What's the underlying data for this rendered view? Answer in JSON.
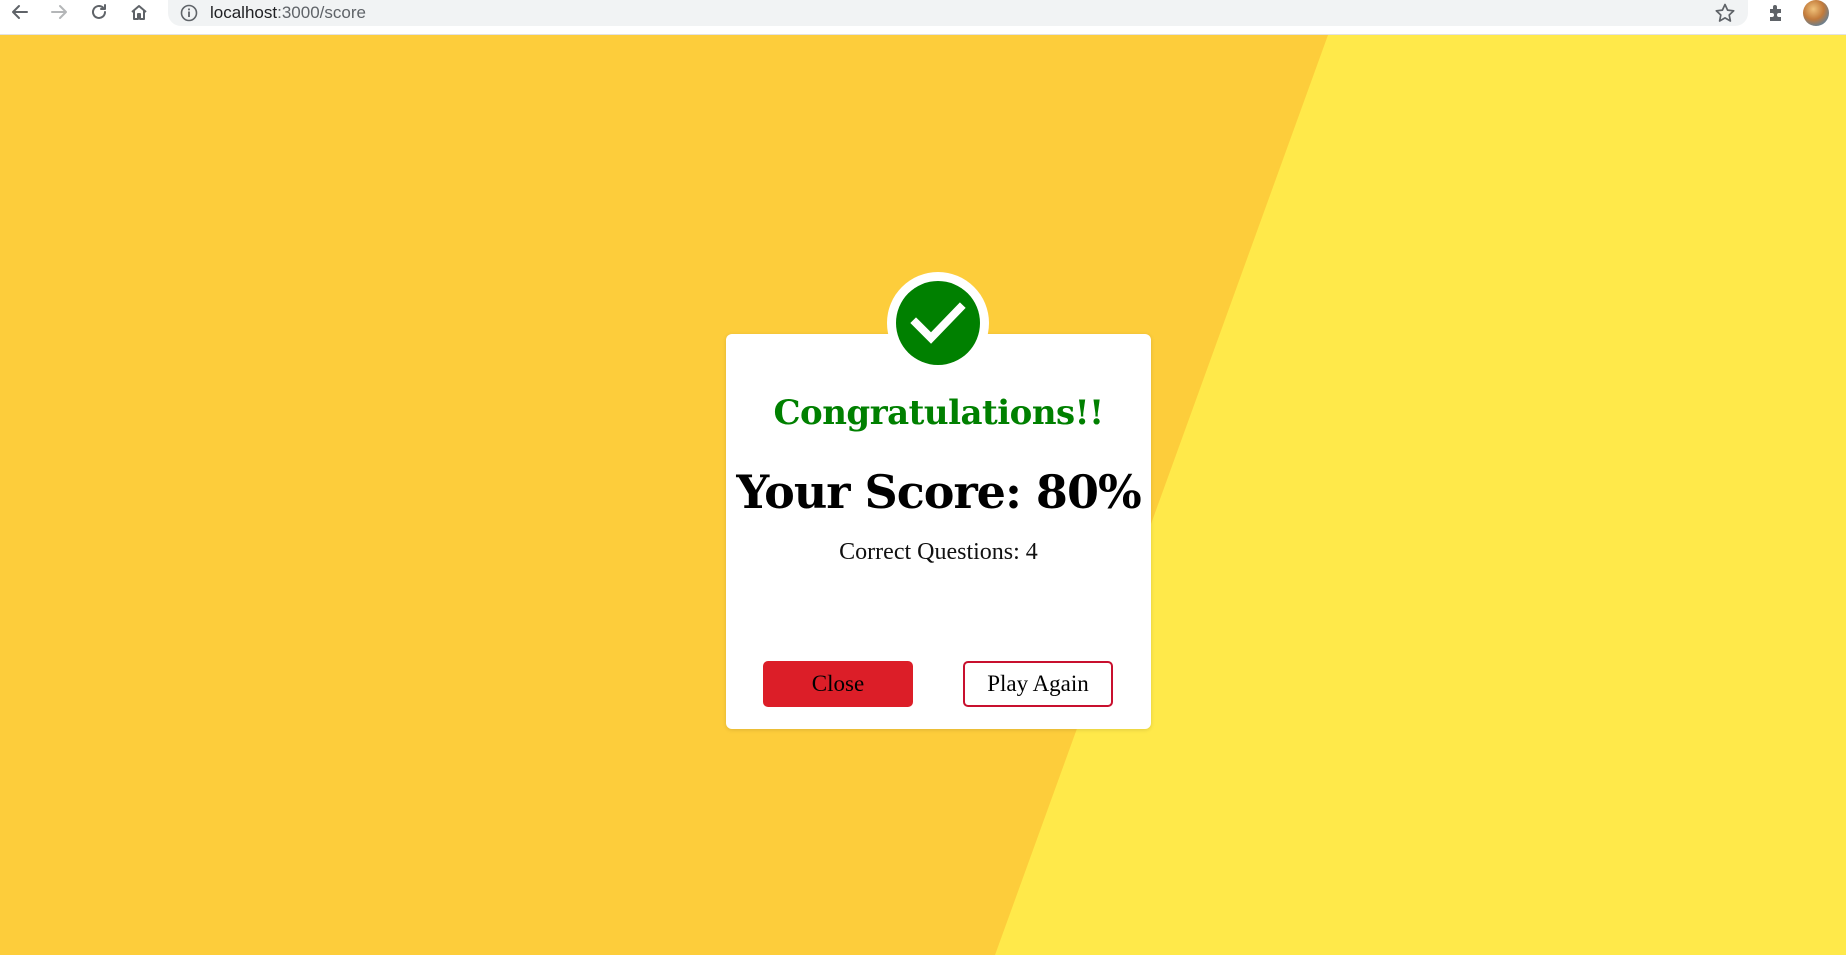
{
  "browser": {
    "url_host": "localhost",
    "url_path": ":3000/score",
    "icons": [
      "back-arrow-icon",
      "forward-arrow-icon",
      "reload-icon",
      "home-icon",
      "info-icon",
      "star-icon",
      "puzzle-icon"
    ]
  },
  "colors": {
    "background_left": "#fdcd3b",
    "background_right": "#ffe94a",
    "success_green": "#008000",
    "close_button": "#dc1e28",
    "play_again_border": "#c8102e"
  },
  "result": {
    "headline": "Congratulations!!",
    "score_text": "Your Score: 80%",
    "correct_text": "Correct Questions: 4",
    "badge_icon": "check-circle-icon"
  },
  "actions": {
    "close_label": "Close",
    "play_again_label": "Play Again"
  }
}
